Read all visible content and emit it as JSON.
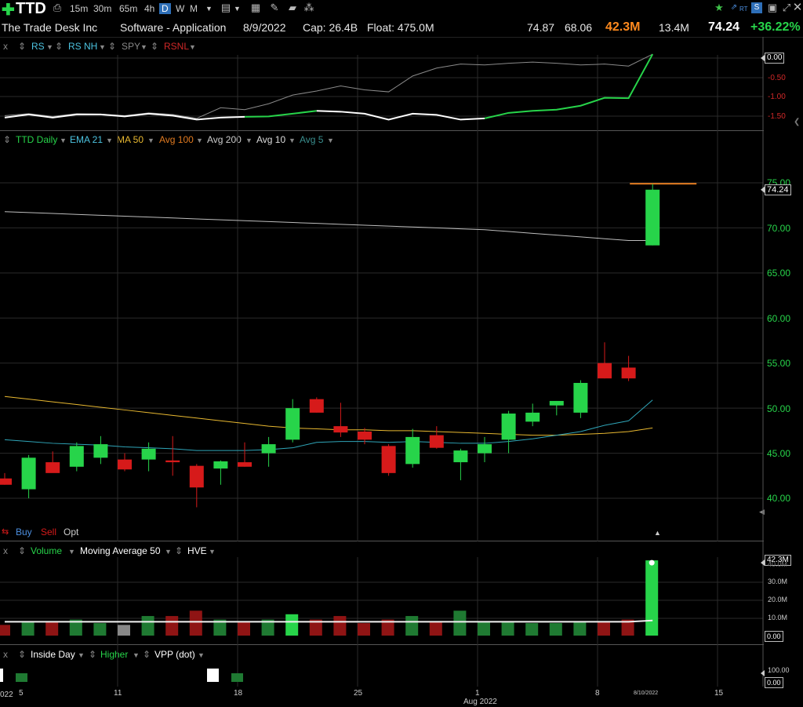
{
  "toolbar": {
    "plus": "✚",
    "ticker": "TTD",
    "intervals": [
      "15m",
      "30m",
      "65m",
      "4h",
      "D",
      "W",
      "M"
    ],
    "active_interval": "D",
    "rt_label": "RT"
  },
  "info": {
    "company": "The Trade Desk Inc",
    "sector": "Software - Application",
    "date": "8/9/2022",
    "cap": "Cap: 26.4B",
    "float": "Float: 475.0M",
    "v1": "74.87",
    "v2": "68.06",
    "volume": "42.3M",
    "avg_volume": "13.4M",
    "price": "74.24",
    "change": "+36.22%"
  },
  "rs_panel": {
    "close": "x",
    "items": [
      {
        "label": "RS",
        "color": "#4cc3e0"
      },
      {
        "label": "RS NH",
        "color": "#4cc3e0"
      },
      {
        "label": "SPY",
        "color": "#888888"
      },
      {
        "label": "RSNL",
        "color": "#d02828"
      }
    ],
    "axis": [
      "0.00",
      "-0.50",
      "-1.00",
      "-1.50"
    ],
    "marker": "0.00"
  },
  "price_panel": {
    "legend": [
      {
        "label": "TTD Daily",
        "color": "#27d44a"
      },
      {
        "label": "EMA 21",
        "color": "#4cc3e0"
      },
      {
        "label": "MA 50",
        "color": "#e8b830"
      },
      {
        "label": "Avg 100",
        "color": "#e07a20"
      },
      {
        "label": "Avg 200",
        "color": "#cccccc"
      },
      {
        "label": "Avg 10",
        "color": "#dddddd"
      },
      {
        "label": "Avg 5",
        "color": "#3a8f8f"
      }
    ],
    "axis": [
      "75.00",
      "70.00",
      "65.00",
      "60.00",
      "55.00",
      "50.00",
      "45.00",
      "40.00"
    ],
    "price_marker": "74.24",
    "buy": "Buy",
    "sell": "Sell",
    "opt": "Opt"
  },
  "volume_panel": {
    "close": "x",
    "items": [
      {
        "label": "Volume",
        "color": "#27d44a"
      },
      {
        "label": "Moving Average 50",
        "color": "#ffffff"
      },
      {
        "label": "HVE",
        "color": "#ffffff"
      }
    ],
    "axis": [
      "40.0M",
      "30.0M",
      "20.0M",
      "10.0M",
      "0.00"
    ],
    "marker": "42.3M"
  },
  "signal_panel": {
    "close": "x",
    "items": [
      {
        "label": "Inside Day",
        "color": "#ffffff"
      },
      {
        "label": "Higher",
        "color": "#27d44a"
      },
      {
        "label": "VPP (dot)",
        "color": "#ffffff"
      }
    ],
    "axis_top": "100.00",
    "axis_bottom": "0.00"
  },
  "x_axis": {
    "labels": [
      "5",
      "11",
      "18",
      "25",
      "1",
      "8",
      "15"
    ],
    "month": "Aug 2022",
    "year_frag": "022",
    "date_marker": "8/10/2022"
  },
  "chart_data": {
    "type": "candlestick",
    "dates": [
      "7/1",
      "7/5",
      "7/6",
      "7/7",
      "7/8",
      "7/11",
      "7/12",
      "7/13",
      "7/14",
      "7/15",
      "7/18",
      "7/19",
      "7/20",
      "7/21",
      "7/22",
      "7/25",
      "7/26",
      "7/27",
      "7/28",
      "7/29",
      "8/1",
      "8/2",
      "8/3",
      "8/4",
      "8/5",
      "8/8",
      "8/9",
      "8/10"
    ],
    "open": [
      42.2,
      41.0,
      44.0,
      43.5,
      44.5,
      44.3,
      44.3,
      44.2,
      43.6,
      43.3,
      44.0,
      45.0,
      46.5,
      51.0,
      48.0,
      47.4,
      45.8,
      43.8,
      47.0,
      44.0,
      45.0,
      46.5,
      48.5,
      50.3,
      49.5,
      55.0,
      54.5,
      68.06
    ],
    "high": [
      42.8,
      44.8,
      45.2,
      46.2,
      46.9,
      45.0,
      46.2,
      46.9,
      43.8,
      44.2,
      46.2,
      46.8,
      51.0,
      51.2,
      50.6,
      47.8,
      46.0,
      47.7,
      48.0,
      45.5,
      46.8,
      49.7,
      50.5,
      50.8,
      53.1,
      57.3,
      55.8,
      74.87
    ],
    "low": [
      41.5,
      40.0,
      43.0,
      43.0,
      43.8,
      43.0,
      43.0,
      42.5,
      39.0,
      41.5,
      43.5,
      43.5,
      46.2,
      49.5,
      46.8,
      46.0,
      42.5,
      43.4,
      45.5,
      42.0,
      44.0,
      45.0,
      48.0,
      49.2,
      48.9,
      53.3,
      53.0,
      68.06
    ],
    "close": [
      41.5,
      44.5,
      42.8,
      45.8,
      46.0,
      43.2,
      45.5,
      44.0,
      41.2,
      44.1,
      43.5,
      46.0,
      50.0,
      49.5,
      47.3,
      46.5,
      42.8,
      46.8,
      45.6,
      45.3,
      46.0,
      49.4,
      49.5,
      50.8,
      52.8,
      53.3,
      53.3,
      74.24
    ],
    "volume_m": [
      6,
      8,
      8,
      9,
      7,
      6,
      11,
      11,
      14,
      9,
      8,
      9,
      12,
      9,
      11,
      7,
      9,
      11,
      8,
      14,
      8,
      8,
      7,
      7,
      8,
      8,
      9,
      42.3
    ],
    "rs_line": [
      -1.55,
      -1.47,
      -1.55,
      -1.47,
      -1.47,
      -1.52,
      -1.45,
      -1.5,
      -1.6,
      -1.55,
      -1.53,
      -1.52,
      -1.45,
      -1.38,
      -1.4,
      -1.45,
      -1.6,
      -1.45,
      -1.48,
      -1.6,
      -1.57,
      -1.43,
      -1.38,
      -1.35,
      -1.25,
      -1.05,
      -1.06,
      0.05
    ],
    "spy_line": [
      -1.5,
      -1.45,
      -1.52,
      -1.45,
      -1.46,
      -1.5,
      -1.43,
      -1.47,
      -1.57,
      -1.3,
      -1.35,
      -1.2,
      -0.98,
      -0.88,
      -0.75,
      -0.85,
      -0.9,
      -0.5,
      -0.3,
      -0.2,
      -0.22,
      -0.18,
      -0.15,
      -0.18,
      -0.22,
      -0.2,
      -0.25,
      0.05
    ],
    "ema21": [
      46.5,
      46.3,
      46.1,
      46.0,
      45.9,
      45.7,
      45.6,
      45.5,
      45.3,
      45.3,
      45.3,
      45.4,
      45.6,
      46.2,
      46.3,
      46.3,
      46.2,
      46.3,
      46.2,
      46.1,
      46.1,
      46.3,
      46.6,
      47.0,
      47.4,
      48.1,
      48.6,
      50.9
    ],
    "ma50": [
      51.3,
      51.0,
      50.7,
      50.4,
      50.1,
      49.8,
      49.5,
      49.2,
      48.9,
      48.6,
      48.3,
      48.0,
      47.8,
      47.7,
      47.6,
      47.6,
      47.5,
      47.5,
      47.4,
      47.3,
      47.2,
      47.1,
      47.0,
      47.0,
      47.1,
      47.2,
      47.4,
      47.8
    ],
    "avg200": [
      71.8,
      71.7,
      71.6,
      71.5,
      71.4,
      71.3,
      71.2,
      71.1,
      71.0,
      70.9,
      70.8,
      70.7,
      70.6,
      70.5,
      70.4,
      70.3,
      70.2,
      70.1,
      70.0,
      69.9,
      69.8,
      69.6,
      69.4,
      69.2,
      69.0,
      68.8,
      68.6,
      68.6
    ],
    "avg100_last": 74.9,
    "ylim": [
      37,
      79
    ],
    "volume_ylim": [
      0,
      45
    ],
    "rs_ylim": [
      -1.75,
      0.15
    ]
  },
  "colors": {
    "up": "#27d44a",
    "down": "#d61a1a",
    "grid": "#2a2a2a",
    "accent_orange": "#ff8a1e"
  }
}
